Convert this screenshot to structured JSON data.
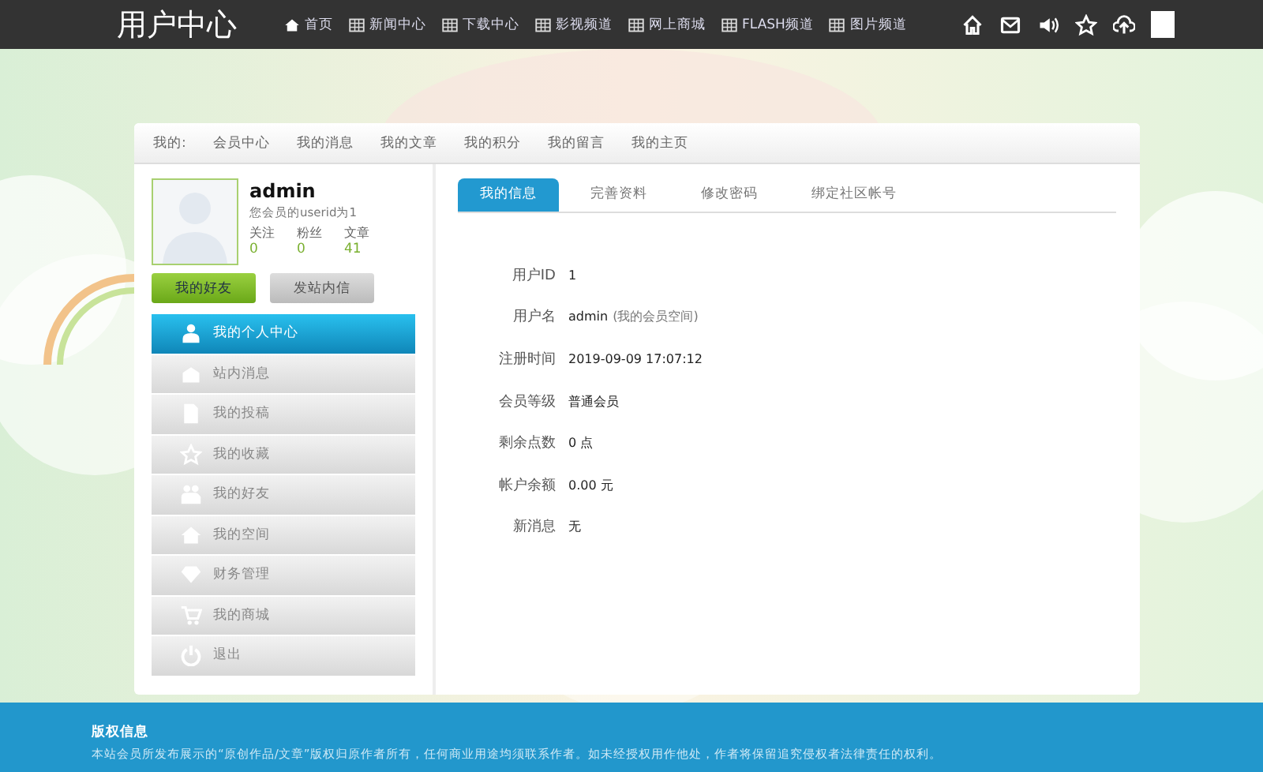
{
  "header": {
    "title": "用户中心",
    "nav": [
      {
        "label": "首页",
        "kind": "home"
      },
      {
        "label": "新闻中心",
        "kind": "grid"
      },
      {
        "label": "下载中心",
        "kind": "grid"
      },
      {
        "label": "影视频道",
        "kind": "grid"
      },
      {
        "label": "网上商城",
        "kind": "grid"
      },
      {
        "label": "FLASH频道",
        "kind": "grid"
      },
      {
        "label": "图片频道",
        "kind": "grid"
      }
    ]
  },
  "subnav": {
    "label": "我的:",
    "items": [
      "会员中心",
      "我的消息",
      "我的文章",
      "我的积分",
      "我的留言",
      "我的主页"
    ]
  },
  "profile": {
    "name": "admin",
    "note": "您会员的userid为1",
    "stats": [
      {
        "label": "关注",
        "value": "0"
      },
      {
        "label": "粉丝",
        "value": "0"
      },
      {
        "label": "文章",
        "value": "41"
      }
    ],
    "buttons": [
      {
        "label": "我的好友",
        "kind": "primary"
      },
      {
        "label": "发站内信",
        "kind": "secondary"
      }
    ]
  },
  "sidebar": {
    "items": [
      {
        "label": "我的个人中心",
        "selected": true
      },
      {
        "label": "站内消息",
        "selected": false
      },
      {
        "label": "我的投稿",
        "selected": false
      },
      {
        "label": "我的收藏",
        "selected": false
      },
      {
        "label": "我的好友",
        "selected": false
      },
      {
        "label": "我的空间",
        "selected": false
      },
      {
        "label": "财务管理",
        "selected": false
      },
      {
        "label": "我的商城",
        "selected": false
      },
      {
        "label": "退出",
        "selected": false
      }
    ]
  },
  "tabs": [
    {
      "label": "我的信息",
      "selected": true
    },
    {
      "label": "完善资料",
      "selected": false
    },
    {
      "label": "修改密码",
      "selected": false
    },
    {
      "label": "绑定社区帐号",
      "selected": false
    }
  ],
  "info": [
    {
      "label": "用户ID",
      "value": "1"
    },
    {
      "label": "用户名",
      "value": "admin",
      "note": "(我的会员空间)"
    },
    {
      "label": "注册时间",
      "value": "2019-09-09 17:07:12"
    },
    {
      "label": "会员等级",
      "value": "普通会员"
    },
    {
      "label": "剩余点数",
      "value": "0 点"
    },
    {
      "label": "帐户余额",
      "value": "0.00 元"
    },
    {
      "label": "新消息",
      "value": "无"
    }
  ],
  "footer": {
    "title": "版权信息",
    "text": "本站会员所发布展示的“原创作品/文章”版权归原作者所有，任何商业用途均须联系作者。如未经授权用作他处，作者将保留追究侵权者法律责任的权利。"
  }
}
